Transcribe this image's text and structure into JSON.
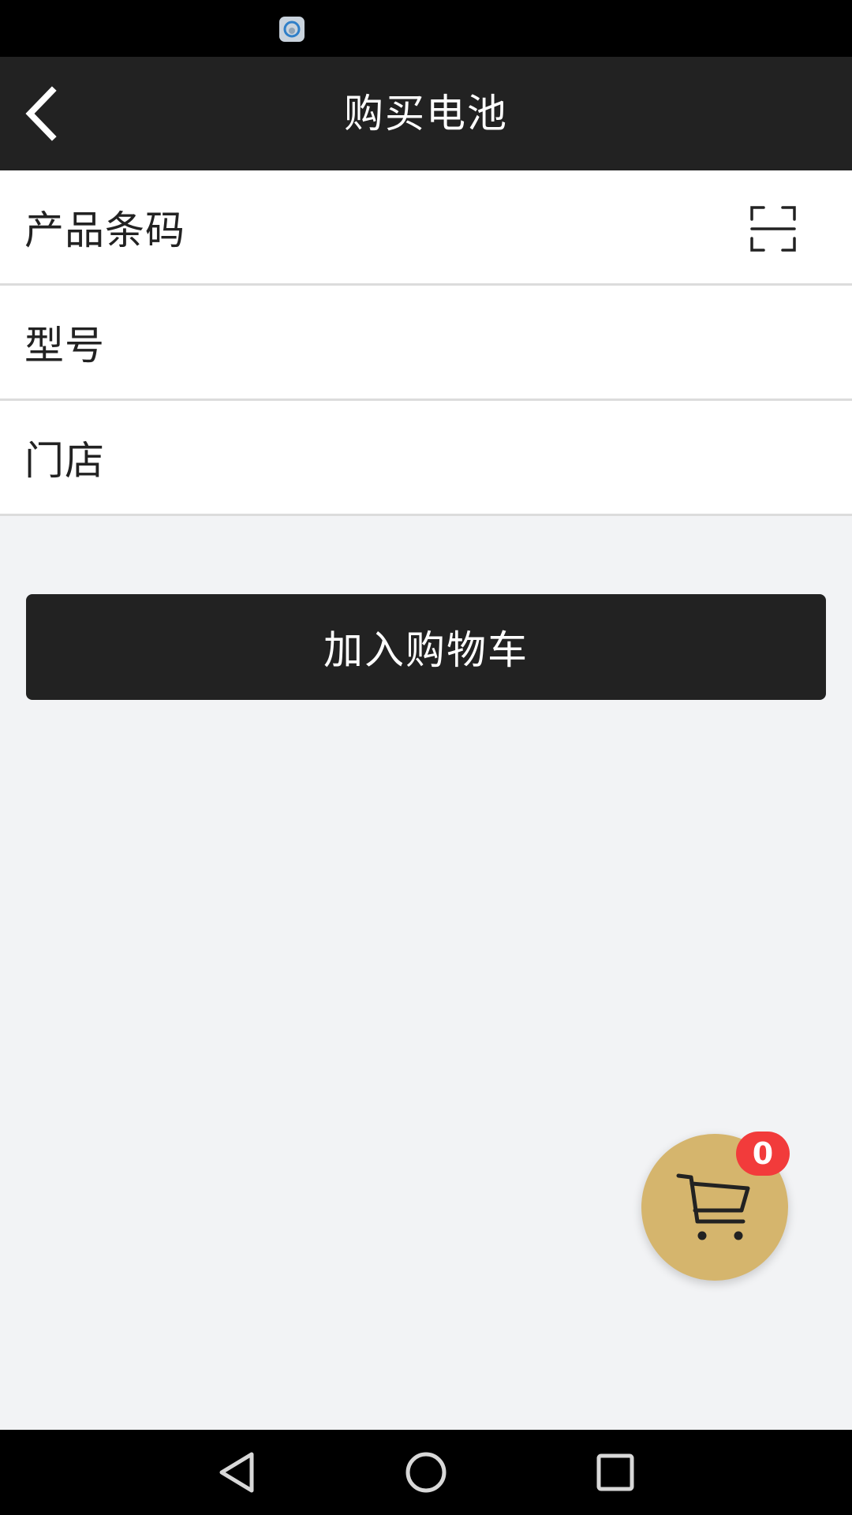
{
  "header": {
    "title": "购买电池",
    "back_icon": "chevron-left-icon"
  },
  "form": {
    "barcode_label": "产品条码",
    "barcode_value": "",
    "scan_icon": "scan-icon",
    "model_label": "型号",
    "model_value": "",
    "store_label": "门店",
    "store_value": ""
  },
  "actions": {
    "add_to_cart_label": "加入购物车"
  },
  "cart": {
    "icon": "cart-icon",
    "count": "0"
  },
  "colors": {
    "header_bg": "#222222",
    "button_bg": "#222222",
    "cart_fab": "#d5b56d",
    "badge": "#f23b3b",
    "page_bg": "#f2f3f5"
  },
  "nav": {
    "back_icon": "nav-back-icon",
    "home_icon": "nav-home-icon",
    "recents_icon": "nav-recents-icon"
  }
}
